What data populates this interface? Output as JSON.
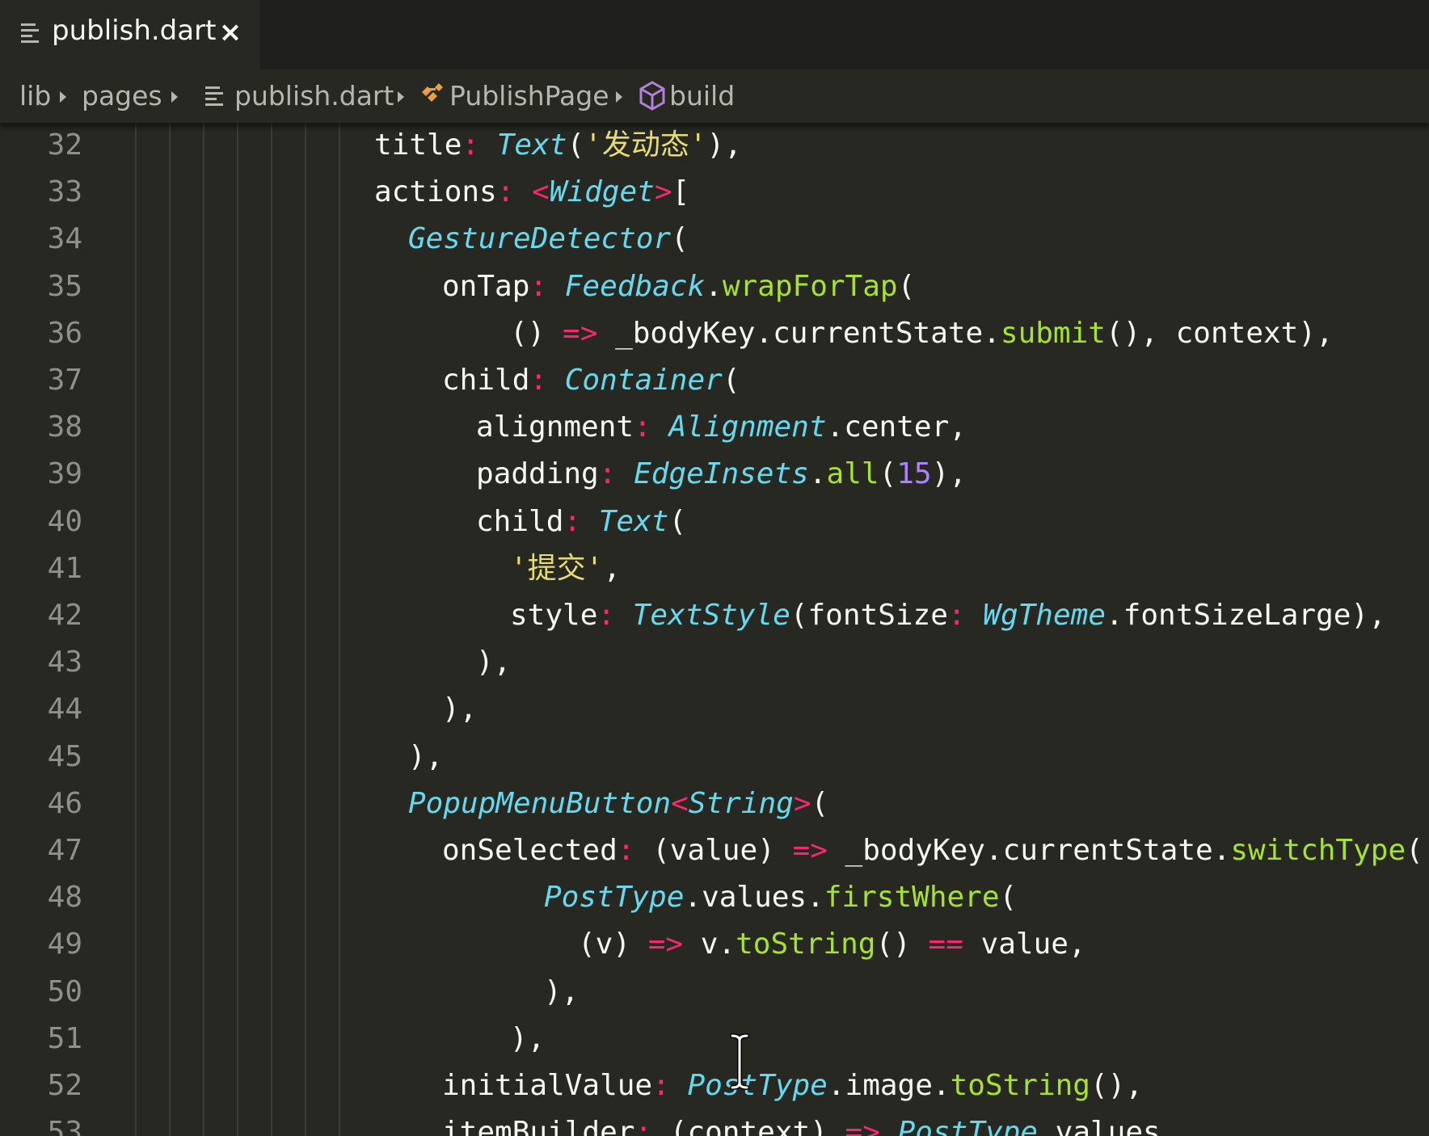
{
  "tab": {
    "label": "publish.dart",
    "close_glyph": "×",
    "file_icon": "lines-file-icon"
  },
  "breadcrumbs": {
    "items": [
      {
        "label": "lib"
      },
      {
        "label": "pages"
      },
      {
        "label": "publish.dart",
        "icon": "lines-file-icon"
      },
      {
        "label": "PublishPage",
        "icon": "class-icon"
      },
      {
        "label": "build",
        "icon": "method-cube-icon"
      }
    ]
  },
  "colors": {
    "background": "#272822",
    "keyword": "#f92672",
    "type": "#66d9ef",
    "string": "#e6db74",
    "function": "#a6e22e",
    "number": "#ae81ff",
    "line_number": "#8f908a"
  },
  "editor": {
    "lines": [
      {
        "number": "32",
        "tokens": [
          {
            "t": "title",
            "k": "plain"
          },
          {
            "t": ":",
            "k": "colon"
          },
          {
            "t": " ",
            "k": "plain"
          },
          {
            "t": "Text",
            "k": "type"
          },
          {
            "t": "(",
            "k": "punc"
          },
          {
            "t": "'发动态'",
            "k": "str"
          },
          {
            "t": "),",
            "k": "punc"
          }
        ]
      },
      {
        "number": "33",
        "tokens": [
          {
            "t": "actions",
            "k": "plain"
          },
          {
            "t": ":",
            "k": "colon"
          },
          {
            "t": " ",
            "k": "plain"
          },
          {
            "t": "<",
            "k": "op"
          },
          {
            "t": "Widget",
            "k": "type"
          },
          {
            "t": ">",
            "k": "op"
          },
          {
            "t": "[",
            "k": "punc"
          }
        ]
      },
      {
        "number": "34",
        "tokens": [
          {
            "t": "GestureDetector",
            "k": "type"
          },
          {
            "t": "(",
            "k": "punc"
          }
        ]
      },
      {
        "number": "35",
        "tokens": [
          {
            "t": "onTap",
            "k": "plain"
          },
          {
            "t": ":",
            "k": "colon"
          },
          {
            "t": " ",
            "k": "plain"
          },
          {
            "t": "Feedback",
            "k": "type"
          },
          {
            "t": ".",
            "k": "punc"
          },
          {
            "t": "wrapForTap",
            "k": "fn"
          },
          {
            "t": "(",
            "k": "punc"
          }
        ]
      },
      {
        "number": "36",
        "tokens": [
          {
            "t": "() ",
            "k": "plain"
          },
          {
            "t": "=>",
            "k": "op"
          },
          {
            "t": " _bodyKey.currentState.",
            "k": "plain"
          },
          {
            "t": "submit",
            "k": "fn"
          },
          {
            "t": "(), context),",
            "k": "plain"
          }
        ]
      },
      {
        "number": "37",
        "tokens": [
          {
            "t": "child",
            "k": "plain"
          },
          {
            "t": ":",
            "k": "colon"
          },
          {
            "t": " ",
            "k": "plain"
          },
          {
            "t": "Container",
            "k": "type"
          },
          {
            "t": "(",
            "k": "punc"
          }
        ]
      },
      {
        "number": "38",
        "tokens": [
          {
            "t": "alignment",
            "k": "plain"
          },
          {
            "t": ":",
            "k": "colon"
          },
          {
            "t": " ",
            "k": "plain"
          },
          {
            "t": "Alignment",
            "k": "type"
          },
          {
            "t": ".center,",
            "k": "plain"
          }
        ]
      },
      {
        "number": "39",
        "tokens": [
          {
            "t": "padding",
            "k": "plain"
          },
          {
            "t": ":",
            "k": "colon"
          },
          {
            "t": " ",
            "k": "plain"
          },
          {
            "t": "EdgeInsets",
            "k": "type"
          },
          {
            "t": ".",
            "k": "punc"
          },
          {
            "t": "all",
            "k": "fn"
          },
          {
            "t": "(",
            "k": "punc"
          },
          {
            "t": "15",
            "k": "num"
          },
          {
            "t": "),",
            "k": "punc"
          }
        ]
      },
      {
        "number": "40",
        "tokens": [
          {
            "t": "child",
            "k": "plain"
          },
          {
            "t": ":",
            "k": "colon"
          },
          {
            "t": " ",
            "k": "plain"
          },
          {
            "t": "Text",
            "k": "type"
          },
          {
            "t": "(",
            "k": "punc"
          }
        ]
      },
      {
        "number": "41",
        "tokens": [
          {
            "t": "'提交'",
            "k": "str"
          },
          {
            "t": ",",
            "k": "punc"
          }
        ]
      },
      {
        "number": "42",
        "tokens": [
          {
            "t": "style",
            "k": "plain"
          },
          {
            "t": ":",
            "k": "colon"
          },
          {
            "t": " ",
            "k": "plain"
          },
          {
            "t": "TextStyle",
            "k": "type"
          },
          {
            "t": "(fontSize",
            "k": "plain"
          },
          {
            "t": ":",
            "k": "colon"
          },
          {
            "t": " ",
            "k": "plain"
          },
          {
            "t": "WgTheme",
            "k": "type"
          },
          {
            "t": ".fontSizeLarge),",
            "k": "plain"
          }
        ]
      },
      {
        "number": "43",
        "tokens": [
          {
            "t": "),",
            "k": "punc"
          }
        ]
      },
      {
        "number": "44",
        "tokens": [
          {
            "t": "),",
            "k": "punc"
          }
        ]
      },
      {
        "number": "45",
        "tokens": [
          {
            "t": "),",
            "k": "punc"
          }
        ]
      },
      {
        "number": "46",
        "tokens": [
          {
            "t": "PopupMenuButton",
            "k": "type"
          },
          {
            "t": "<",
            "k": "op"
          },
          {
            "t": "String",
            "k": "type"
          },
          {
            "t": ">",
            "k": "op"
          },
          {
            "t": "(",
            "k": "punc"
          }
        ]
      },
      {
        "number": "47",
        "tokens": [
          {
            "t": "onSelected",
            "k": "plain"
          },
          {
            "t": ":",
            "k": "colon"
          },
          {
            "t": " (value) ",
            "k": "plain"
          },
          {
            "t": "=>",
            "k": "op"
          },
          {
            "t": " _bodyKey.currentState.",
            "k": "plain"
          },
          {
            "t": "switchType",
            "k": "fn"
          },
          {
            "t": "(",
            "k": "punc"
          }
        ]
      },
      {
        "number": "48",
        "tokens": [
          {
            "t": "PostType",
            "k": "type"
          },
          {
            "t": ".values.",
            "k": "plain"
          },
          {
            "t": "firstWhere",
            "k": "fn"
          },
          {
            "t": "(",
            "k": "punc"
          }
        ]
      },
      {
        "number": "49",
        "tokens": [
          {
            "t": "(v) ",
            "k": "plain"
          },
          {
            "t": "=>",
            "k": "op"
          },
          {
            "t": " v.",
            "k": "plain"
          },
          {
            "t": "toString",
            "k": "fn"
          },
          {
            "t": "() ",
            "k": "plain"
          },
          {
            "t": "==",
            "k": "op"
          },
          {
            "t": " value,",
            "k": "plain"
          }
        ]
      },
      {
        "number": "50",
        "tokens": [
          {
            "t": "),",
            "k": "punc"
          }
        ]
      },
      {
        "number": "51",
        "tokens": [
          {
            "t": "),",
            "k": "punc"
          }
        ]
      },
      {
        "number": "52",
        "tokens": [
          {
            "t": "initialValue",
            "k": "plain"
          },
          {
            "t": ":",
            "k": "colon"
          },
          {
            "t": " ",
            "k": "plain"
          },
          {
            "t": "PostType",
            "k": "type"
          },
          {
            "t": ".image.",
            "k": "plain"
          },
          {
            "t": "toString",
            "k": "fn"
          },
          {
            "t": "(),",
            "k": "plain"
          }
        ]
      },
      {
        "number": "53",
        "tokens": [
          {
            "t": "itemBuilder",
            "k": "plain"
          },
          {
            "t": ":",
            "k": "colon"
          },
          {
            "t": " (context) ",
            "k": "plain"
          },
          {
            "t": "=>",
            "k": "op"
          },
          {
            "t": " ",
            "k": "plain"
          },
          {
            "t": "PostType",
            "k": "type"
          },
          {
            "t": ".values",
            "k": "plain"
          }
        ]
      }
    ]
  }
}
